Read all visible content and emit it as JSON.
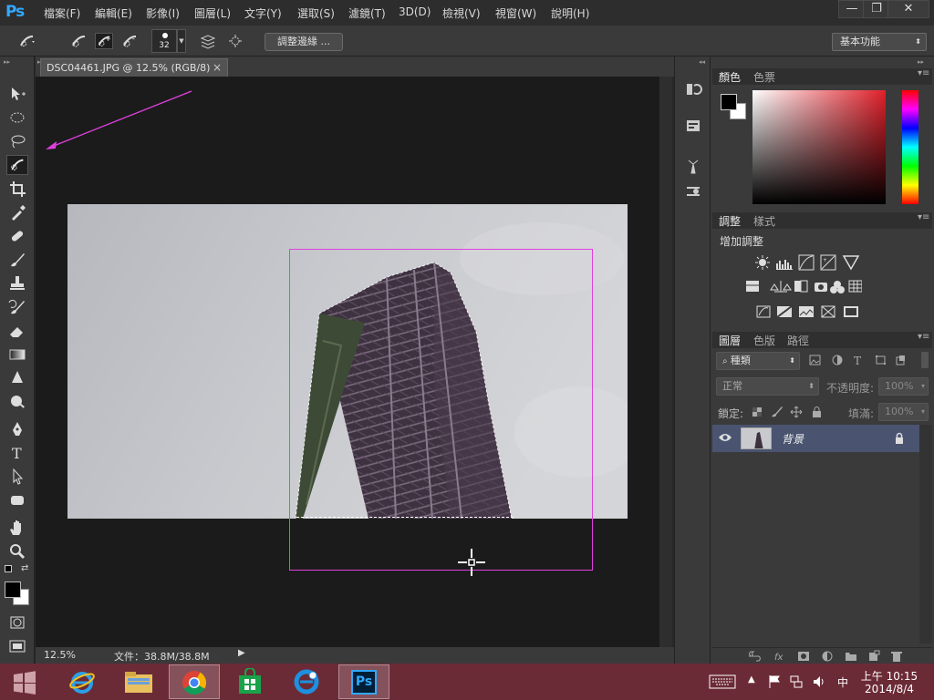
{
  "app": {
    "logo": "Ps"
  },
  "menu": [
    "檔案(F)",
    "編輯(E)",
    "影像(I)",
    "圖層(L)",
    "文字(Y)",
    "選取(S)",
    "濾鏡(T)",
    "3D(D)",
    "檢視(V)",
    "視窗(W)",
    "說明(H)"
  ],
  "window_controls": {
    "minimize": "—",
    "restore": "❐",
    "close": "✕"
  },
  "options": {
    "brush_size": "32",
    "refine_edge": "調整邊緣 ...",
    "workspace": "基本功能"
  },
  "document": {
    "tab_title": "DSC04461.JPG @ 12.5% (RGB/8)",
    "tab_close": "×"
  },
  "status": {
    "zoom": "12.5%",
    "doc_info": "文件：38.8M/38.8M"
  },
  "panels": {
    "color": {
      "tabs": [
        "顏色",
        "色票"
      ]
    },
    "adjust": {
      "tabs": [
        "調整",
        "樣式"
      ],
      "title": "增加調整"
    },
    "layers": {
      "tabs": [
        "圖層",
        "色版",
        "路徑"
      ],
      "filter": "種類",
      "blend": "正常",
      "opacity_label": "不透明度:",
      "opacity": "100%",
      "lock_label": "鎖定:",
      "fill_label": "填滿:",
      "fill": "100%",
      "layer_name": "背景"
    }
  },
  "taskbar": {
    "time": "上午 10:15",
    "date": "2014/8/4",
    "ime": "中"
  },
  "colors": {
    "accent": "#31a8ff",
    "selection": "#e040e0",
    "taskbar": "#6b2b36",
    "layer_selected": "#4a5470"
  }
}
